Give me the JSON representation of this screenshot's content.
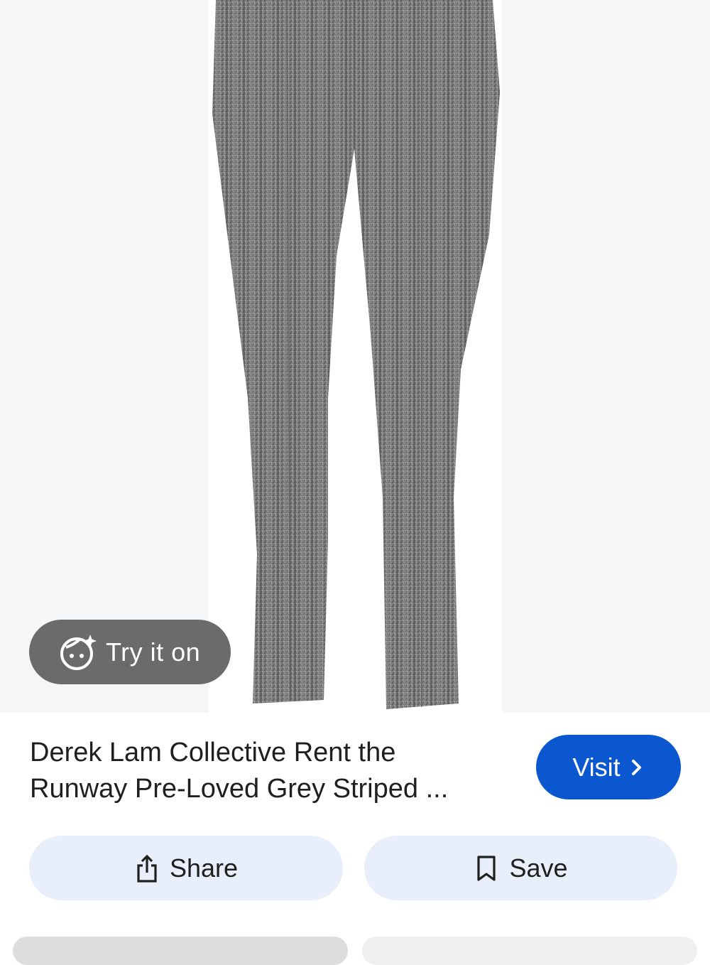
{
  "hero": {
    "try_on_label": "Try it on",
    "try_on_icon": "face-sparkle-icon",
    "image_icon": "trousers-product-image"
  },
  "product": {
    "title_line1": "Derek Lam Collective Rent the",
    "title_line2": "Runway Pre-Loved Grey Striped ..."
  },
  "actions": {
    "visit_label": "Visit",
    "visit_icon": "chevron-right-icon",
    "share_label": "Share",
    "share_icon": "share-icon",
    "save_label": "Save",
    "save_icon": "bookmark-icon"
  },
  "colors": {
    "accent": "#0b57d0",
    "tonal_button": "#e8eefa",
    "chip_bg": "#6b6b6b"
  }
}
